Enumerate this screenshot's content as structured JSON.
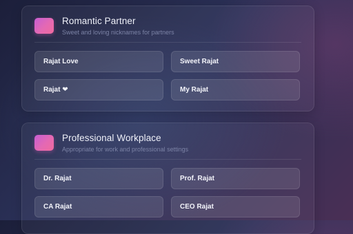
{
  "cards": [
    {
      "title": "Romantic Partner",
      "subtitle": "Sweet and loving nicknames for partners",
      "icon": "gradient-square-icon",
      "nicknames": [
        "Rajat Love",
        "Sweet Rajat",
        "Rajat ❤",
        "My Rajat"
      ]
    },
    {
      "title": "Professional Workplace",
      "subtitle": "Appropriate for work and professional settings",
      "icon": "gradient-square-icon",
      "nicknames": [
        "Dr. Rajat",
        "Prof. Rajat",
        "CA Rajat",
        "CEO Rajat"
      ]
    }
  ],
  "colors": {
    "icon_gradient_start": "#c65ed2",
    "icon_gradient_end": "#f06a9e",
    "title": "#eef0f8",
    "subtitle": "#7c83a6"
  }
}
